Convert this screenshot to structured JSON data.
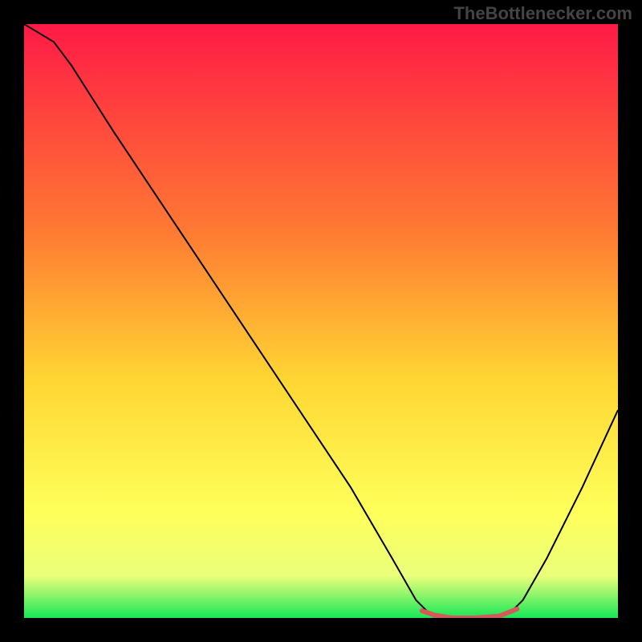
{
  "watermark": "TheBottlenecker.com",
  "chart_data": {
    "type": "line",
    "title": "",
    "xlabel": "",
    "ylabel": "",
    "xlim": [
      0,
      100
    ],
    "ylim": [
      0,
      100
    ],
    "gradient_stops": [
      {
        "offset": 0,
        "color": "#ff1a46"
      },
      {
        "offset": 35,
        "color": "#ff7a33"
      },
      {
        "offset": 60,
        "color": "#ffd633"
      },
      {
        "offset": 82,
        "color": "#ffff5a"
      },
      {
        "offset": 93,
        "color": "#eaff7a"
      },
      {
        "offset": 100,
        "color": "#18e858"
      }
    ],
    "series": [
      {
        "name": "bottleneck-curve",
        "color": "#000000",
        "width": 2,
        "points": [
          {
            "x": 0,
            "y": 100
          },
          {
            "x": 5,
            "y": 97
          },
          {
            "x": 8,
            "y": 93
          },
          {
            "x": 15,
            "y": 82
          },
          {
            "x": 25,
            "y": 67
          },
          {
            "x": 35,
            "y": 52
          },
          {
            "x": 45,
            "y": 37
          },
          {
            "x": 55,
            "y": 22
          },
          {
            "x": 62,
            "y": 10
          },
          {
            "x": 66,
            "y": 3
          },
          {
            "x": 68,
            "y": 1
          },
          {
            "x": 72,
            "y": 0
          },
          {
            "x": 78,
            "y": 0
          },
          {
            "x": 82,
            "y": 1
          },
          {
            "x": 84,
            "y": 3
          },
          {
            "x": 88,
            "y": 10
          },
          {
            "x": 94,
            "y": 22
          },
          {
            "x": 100,
            "y": 35
          }
        ]
      },
      {
        "name": "optimal-flat-highlight",
        "color": "#d45a5a",
        "width": 6,
        "points": [
          {
            "x": 67,
            "y": 1.2
          },
          {
            "x": 69,
            "y": 0.5
          },
          {
            "x": 72,
            "y": 0
          },
          {
            "x": 76,
            "y": 0
          },
          {
            "x": 80,
            "y": 0.3
          },
          {
            "x": 83,
            "y": 1.5
          }
        ]
      }
    ]
  }
}
